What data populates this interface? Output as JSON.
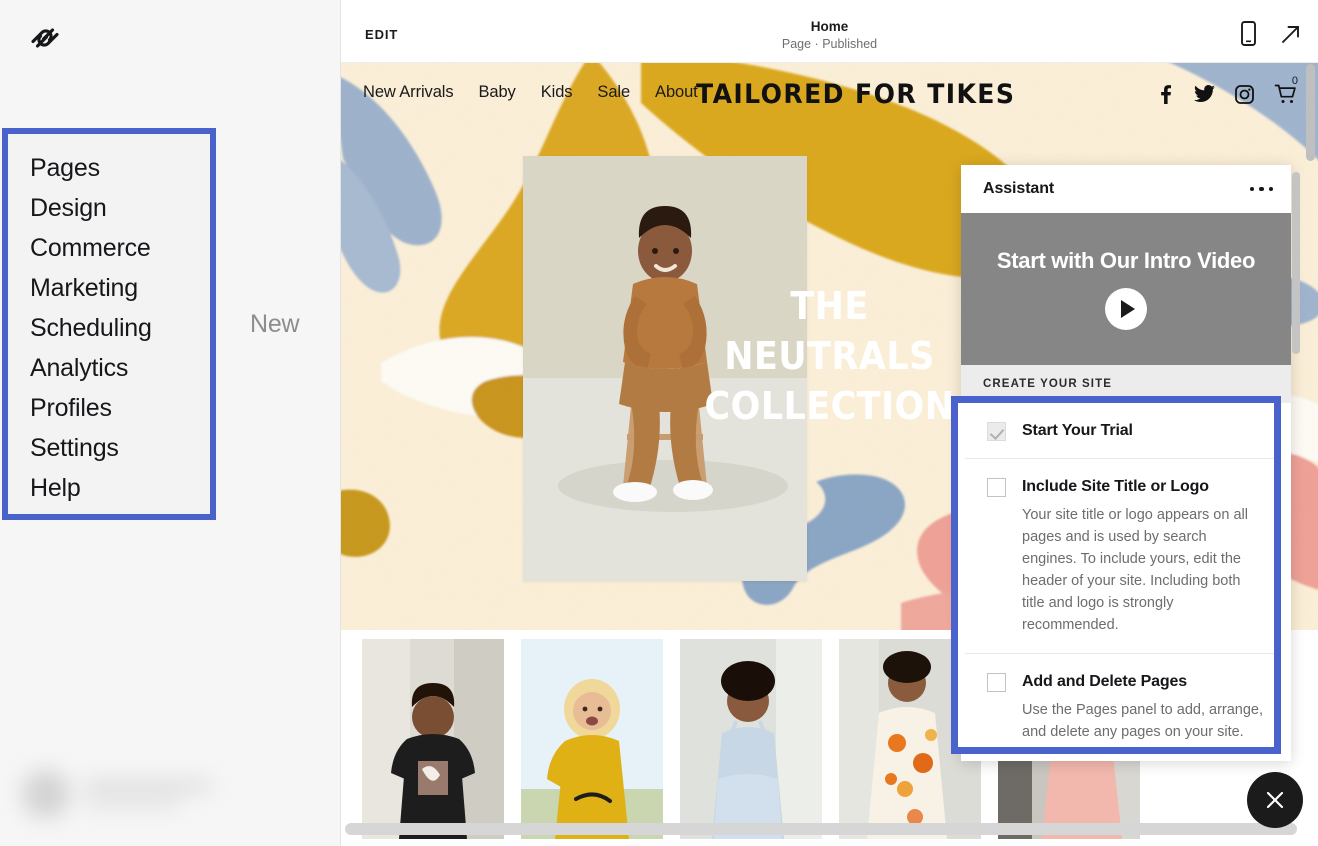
{
  "sidebar": {
    "logo_icon": "squarespace-logo",
    "items": [
      {
        "label": "Pages"
      },
      {
        "label": "Design"
      },
      {
        "label": "Commerce"
      },
      {
        "label": "Marketing"
      },
      {
        "label": "Scheduling"
      },
      {
        "label": "Analytics"
      },
      {
        "label": "Profiles"
      },
      {
        "label": "Settings"
      },
      {
        "label": "Help"
      }
    ],
    "new_badge": "New"
  },
  "topbar": {
    "edit_label": "EDIT",
    "page_title": "Home",
    "page_status": "Page · Published",
    "mobile_icon": "mobile-device-icon",
    "external_icon": "open-external-icon"
  },
  "site": {
    "nav": [
      {
        "label": "New Arrivals"
      },
      {
        "label": "Baby"
      },
      {
        "label": "Kids"
      },
      {
        "label": "Sale"
      },
      {
        "label": "About"
      }
    ],
    "logo_text": "TAILORED FOR TIKES",
    "social": [
      {
        "icon": "facebook-icon"
      },
      {
        "icon": "twitter-icon"
      },
      {
        "icon": "instagram-icon"
      },
      {
        "icon": "shopping-cart-icon"
      }
    ],
    "cart_count": "0",
    "hero_headline": "THE\nNEUTRALS\nCOLLECTION",
    "hero_headline_lines": [
      "THE",
      "NEUTRALS",
      "COLLECTION"
    ],
    "colors": {
      "hero_background": "#fbefd8",
      "accent_gold": "#d9a520",
      "accent_blue": "#8aa6c4",
      "accent_salmon": "#efa196",
      "accent_white": "#fdfbf4"
    }
  },
  "assistant": {
    "title": "Assistant",
    "overflow_icon": "more-options-icon",
    "video": {
      "title": "Start with Our Intro Video",
      "play_icon": "play-icon"
    },
    "section_label": "CREATE YOUR SITE",
    "checklist": [
      {
        "title": "Start Your Trial",
        "description": "",
        "checked": true
      },
      {
        "title": "Include Site Title or Logo",
        "description": "Your site title or logo appears on all pages and is used by search engines. To include yours, edit the header of your site. Including both title and logo is strongly recommended.",
        "checked": false
      },
      {
        "title": "Add and Delete Pages",
        "description": "Use the Pages panel to add, arrange, and delete any pages on your site.",
        "checked": false
      }
    ]
  },
  "fab": {
    "close_icon": "close-icon"
  },
  "highlight_color": "#4a63cc"
}
